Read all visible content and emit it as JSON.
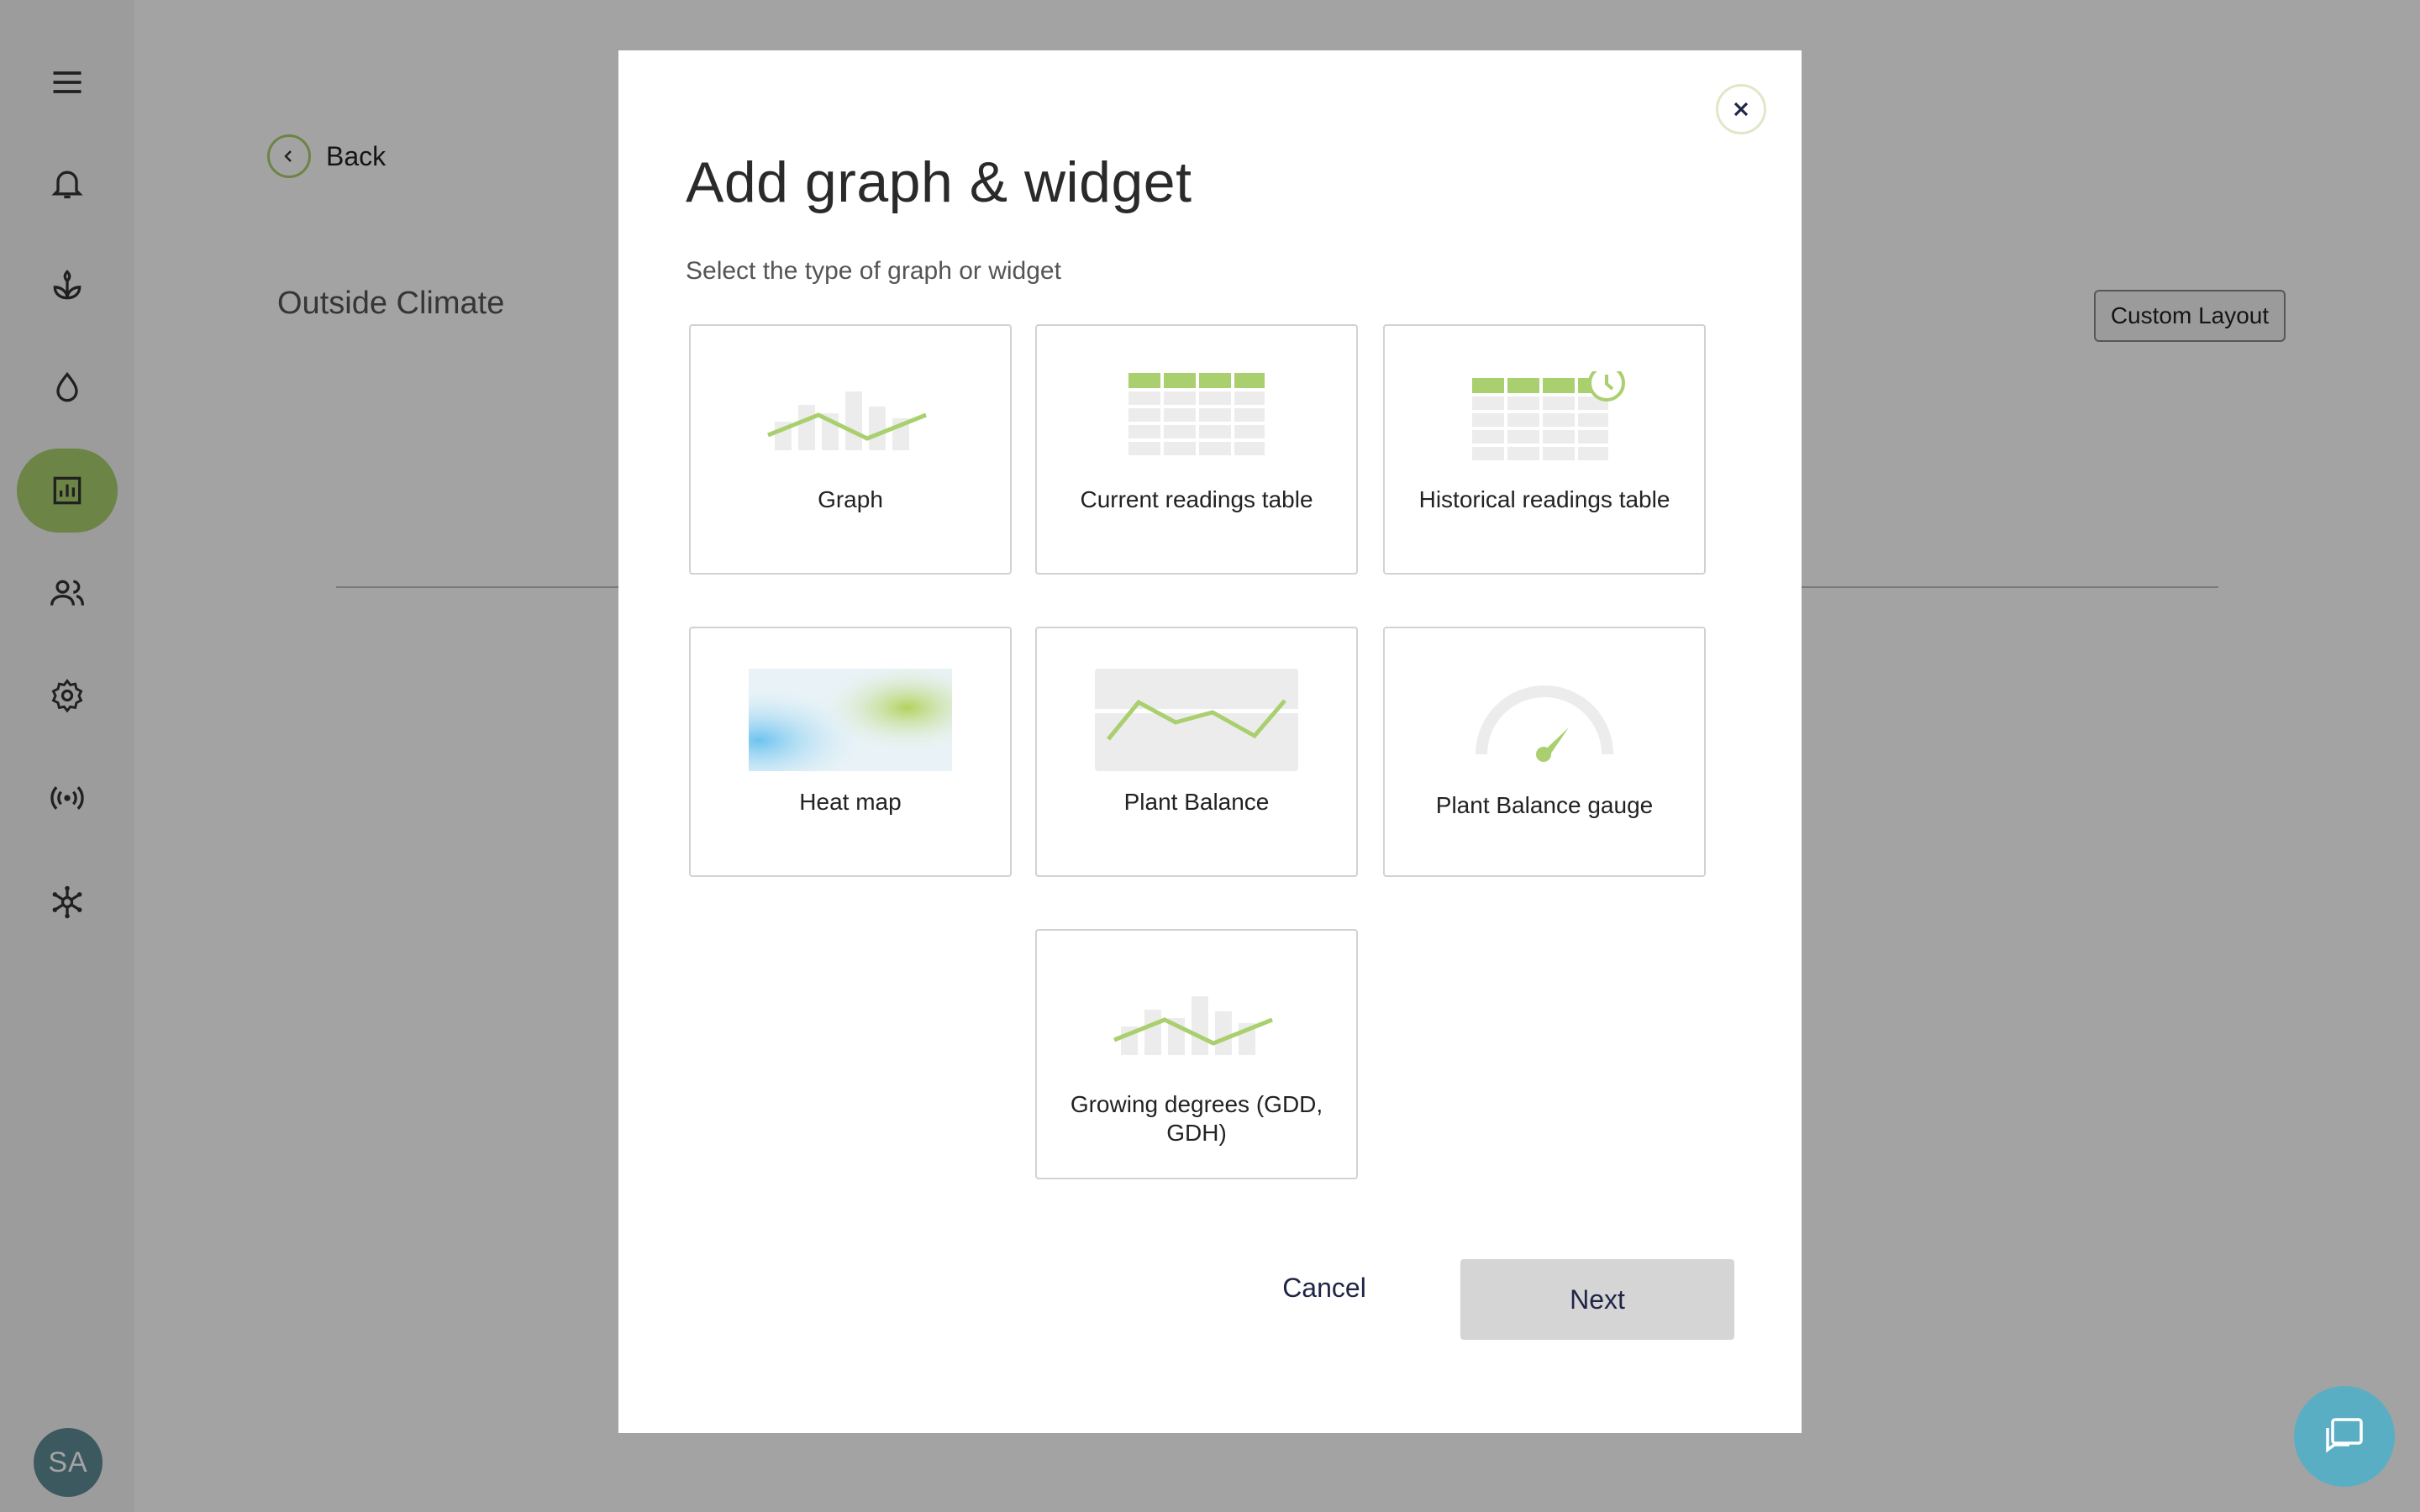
{
  "background": {
    "back_label": "Back",
    "page_title": "Outside Climate",
    "custom_layout_label": "Custom Layout",
    "avatar_initials": "SA",
    "sidebar_icons": [
      "menu-icon",
      "bell-icon",
      "plant-icon",
      "water-drop-icon",
      "report-chart-icon",
      "users-icon",
      "gear-icon",
      "sensor-signal-icon",
      "network-icon"
    ],
    "active_nav": "report-chart-icon"
  },
  "modal": {
    "title": "Add graph & widget",
    "subtitle": "Select the type of graph or widget",
    "options": [
      {
        "label": "Graph",
        "icon": "graph-icon"
      },
      {
        "label": "Current readings table",
        "icon": "table-icon"
      },
      {
        "label": "Historical readings table",
        "icon": "history-table-icon"
      },
      {
        "label": "Heat map",
        "icon": "heat-map-icon"
      },
      {
        "label": "Plant Balance",
        "icon": "plant-balance-icon"
      },
      {
        "label": "Plant Balance gauge",
        "icon": "gauge-icon"
      },
      {
        "label": "Growing degrees (GDD, GDH)",
        "icon": "growing-degrees-icon"
      }
    ],
    "cancel_label": "Cancel",
    "next_label": "Next"
  },
  "colors": {
    "accent_green": "#a9cf6e",
    "overlay": "rgba(0,0,0,0.36)",
    "chat_button": "#5aaec4",
    "next_disabled": "#d5d5d5",
    "button_text": "#1f2545"
  }
}
